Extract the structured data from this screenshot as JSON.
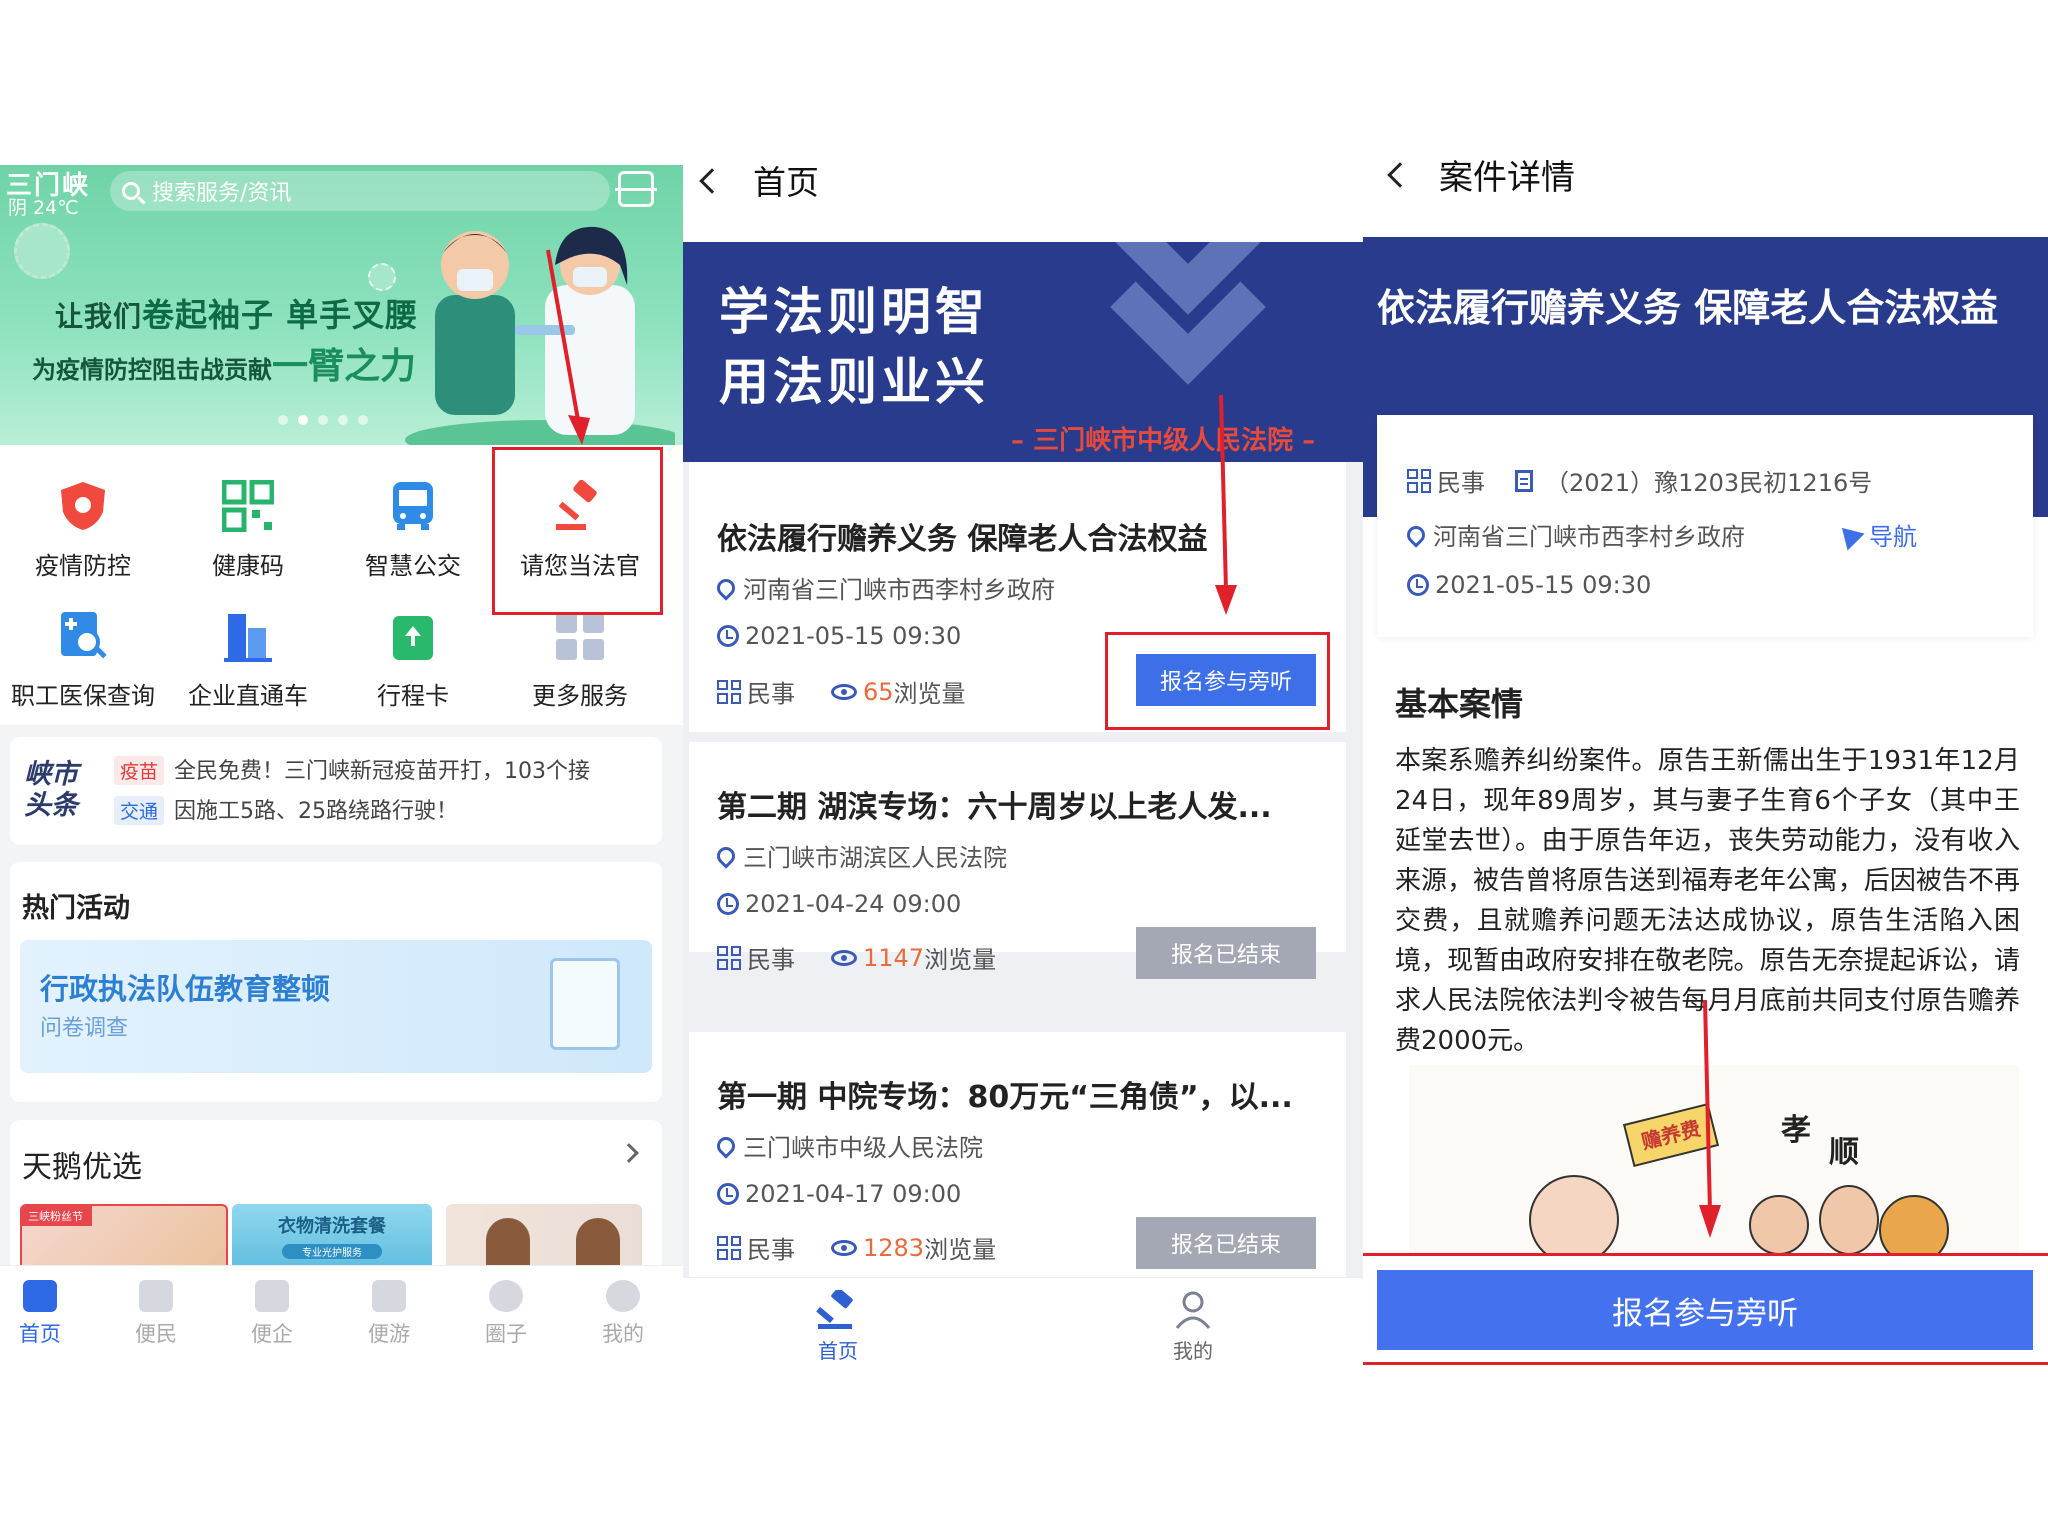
{
  "panel1": {
    "city": "三门峡",
    "weather": "阴 24℃",
    "search_placeholder": "搜索服务/资讯",
    "slogan_line1_a": "让我们",
    "slogan_line1_b": "卷起袖子 单手叉腰",
    "slogan_line2_a": "为疫情防控阻击战贡献",
    "slogan_line2_b": "一臂之力",
    "services": [
      {
        "label": "疫情防控",
        "icon": "shield-virus-icon"
      },
      {
        "label": "健康码",
        "icon": "qr-code-icon"
      },
      {
        "label": "智慧公交",
        "icon": "bus-icon"
      },
      {
        "label": "请您当法官",
        "icon": "gavel-icon"
      },
      {
        "label": "职工医保查询",
        "icon": "medical-search-icon"
      },
      {
        "label": "企业直通车",
        "icon": "building-icon"
      },
      {
        "label": "行程卡",
        "icon": "itinerary-card-icon"
      },
      {
        "label": "更多服务",
        "icon": "more-grid-icon"
      }
    ],
    "news_logo": "峡市头条",
    "news": [
      {
        "tag": "疫苗",
        "text": "全民免费！三门峡新冠疫苗开打，103个接"
      },
      {
        "tag": "交通",
        "text": "因施工5路、25路绕路行驶！"
      }
    ],
    "hot_title": "热门活动",
    "hot_card_title": "行政执法队伍教育整顿",
    "hot_card_sub": "问卷调查",
    "tian_title": "天鹅优选",
    "thumb_texts": [
      "三峡粉丝节",
      "衣物清洗套餐",
      "专业光护服务"
    ],
    "tabs": [
      "首页",
      "便民",
      "便企",
      "便游",
      "圈子",
      "我的"
    ]
  },
  "panel2": {
    "title": "首页",
    "banner_line1": "学法则明智",
    "banner_line2": "用法则业兴",
    "court": "三门峡市中级人民法院",
    "cards": [
      {
        "title": "依法履行赡养义务 保障老人合法权益",
        "location": "河南省三门峡市西李村乡政府",
        "time": "2021-05-15 09:30",
        "category": "民事",
        "views": "65",
        "views_label": "浏览量",
        "button": "报名参与旁听"
      },
      {
        "title": "第二期 湖滨专场：六十周岁以上老人发...",
        "location": "三门峡市湖滨区人民法院",
        "time": "2021-04-24 09:00",
        "category": "民事",
        "views": "1147",
        "views_label": "浏览量",
        "button": "报名已结束"
      },
      {
        "title": "第一期 中院专场：80万元“三角债”，以...",
        "location": "三门峡市中级人民法院",
        "time": "2021-04-17 09:00",
        "category": "民事",
        "views": "1283",
        "views_label": "浏览量",
        "button": "报名已结束"
      }
    ],
    "tabs": [
      "首页",
      "我的"
    ]
  },
  "panel3": {
    "title": "案件详情",
    "banner_title": "依法履行赡养义务 保障老人合法权益",
    "category": "民事",
    "case_no": "（2021）豫1203民初1216号",
    "location": "河南省三门峡市西李村乡政府",
    "nav": "导航",
    "time": "2021-05-15 09:30",
    "section": "基本案情",
    "body": "本案系赡养纠纷案件。原告王新儒出生于1931年12月24日，现年89周岁，其与妻子生育6个子女（其中王延堂去世）。由于原告年迈，丧失劳动能力，没有收入来源，被告曾将原告送到福寿老年公寓，后因被告不再交费，且就赡养问题无法达成协议，原告生活陷入困境，现暂由政府安排在敬老院。原告无奈提起诉讼，请求人民法院依法判令被告每月月底前共同支付原告赡养费2000元。",
    "pic_sign": "赡养费",
    "pic_word1": "孝",
    "pic_word2": "顺",
    "button": "报名参与旁听"
  },
  "colors": {
    "primary_blue": "#3d6fe8",
    "navy": "#283b8c",
    "highlight_red": "#e0202a",
    "green": "#6fd3a7"
  }
}
